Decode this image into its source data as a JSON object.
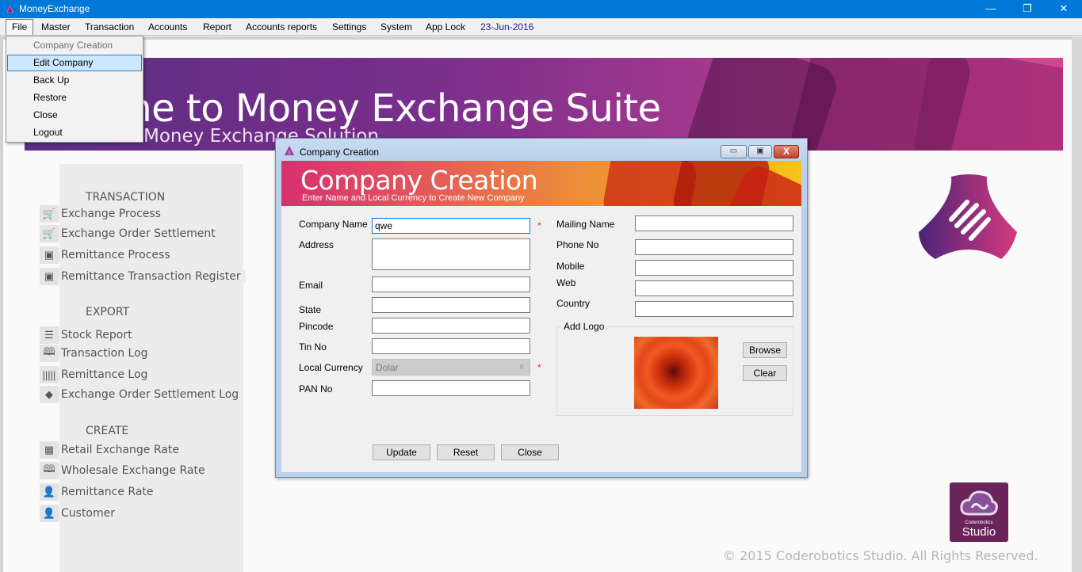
{
  "window": {
    "title": "MoneyExchange",
    "controls": {
      "minimize": "—",
      "restore": "❐",
      "close": "✕"
    }
  },
  "menubar": {
    "items": [
      "File",
      "Master",
      "Transaction",
      "Accounts",
      "Report",
      "Accounts reports",
      "Settings",
      "System",
      "App Lock"
    ],
    "date": "23-Jun-2016",
    "active": "File"
  },
  "file_menu": {
    "items": [
      {
        "label": "Company Creation",
        "state": "disabled"
      },
      {
        "label": "Edit Company",
        "state": "hover"
      },
      {
        "label": "Back Up",
        "state": "normal"
      },
      {
        "label": "Restore",
        "state": "normal"
      },
      {
        "label": "Close",
        "state": "normal"
      },
      {
        "label": "Logout",
        "state": "normal"
      }
    ]
  },
  "banner": {
    "title": "Welcome to Money Exchange Suite",
    "visible_title": "ome to Money Exchange Suite",
    "subtitle": "Complete Money Exchange Solution",
    "visible_subtitle": "Money Exchange Solution"
  },
  "sidebar": {
    "sections": [
      {
        "heading": "TRANSACTION",
        "items": [
          {
            "label": "Exchange Process",
            "icon": "cart-icon"
          },
          {
            "label": "Exchange Order Settlement",
            "icon": "cart-settle-icon"
          },
          {
            "label": "Remittance Process",
            "icon": "wallet-icon"
          },
          {
            "label": "Remittance Transaction Register",
            "icon": "wallet-icon"
          }
        ]
      },
      {
        "heading": "EXPORT",
        "items": [
          {
            "label": "Stock Report",
            "icon": "stock-list-icon"
          },
          {
            "label": "Transaction Log",
            "icon": "book-icon"
          },
          {
            "label": "Remittance Log",
            "icon": "barcode-icon"
          },
          {
            "label": "Exchange Order Settlement Log",
            "icon": "tag-icon"
          }
        ]
      },
      {
        "heading": "CREATE",
        "items": [
          {
            "label": "Retail Exchange Rate",
            "icon": "counter-icon"
          },
          {
            "label": "Wholesale Exchange Rate",
            "icon": "book-icon"
          },
          {
            "label": "Remittance Rate",
            "icon": "person-icon"
          },
          {
            "label": "Customer",
            "icon": "person-icon"
          }
        ]
      }
    ]
  },
  "dialog": {
    "title": "Company Creation",
    "banner_title": "Company Creation",
    "banner_subtitle": "Enter Name and Local Currency to Create New Company",
    "fields_left": {
      "company_name": {
        "label": "Company Name",
        "value": "qwe",
        "required": true
      },
      "address": {
        "label": "Address",
        "value": ""
      },
      "email": {
        "label": "Email",
        "value": ""
      },
      "state": {
        "label": "State",
        "value": ""
      },
      "pincode": {
        "label": "Pincode",
        "value": ""
      },
      "tin_no": {
        "label": "Tin No",
        "value": ""
      },
      "local_currency": {
        "label": "Local Currency",
        "value": "Dolar",
        "required": true
      },
      "pan_no": {
        "label": "PAN No",
        "value": ""
      }
    },
    "fields_right": {
      "mailing_name": {
        "label": "Mailing Name",
        "value": ""
      },
      "phone_no": {
        "label": "Phone No",
        "value": ""
      },
      "mobile": {
        "label": "Mobile",
        "value": ""
      },
      "web": {
        "label": "Web",
        "value": ""
      },
      "country": {
        "label": "Country",
        "value": ""
      }
    },
    "required_mark": "*",
    "logo_group": {
      "label": "Add Logo",
      "browse": "Browse",
      "clear": "Clear"
    },
    "buttons": {
      "update": "Update",
      "reset": "Reset",
      "close": "Close"
    },
    "controls": {
      "minimize": "▭",
      "maximize": "▣",
      "close": "X"
    }
  },
  "footer": {
    "studio_small": "Coderobotics",
    "studio_big": "Studio",
    "copyright": "© 2015 Coderobotics Studio. All Rights Reserved."
  },
  "colors": {
    "titlebar": "#0078d7",
    "banner_start": "#5c2d82",
    "banner_end": "#d8458f",
    "dialog_frame": "#b9d1ea",
    "menu_hover": "#cce8ff",
    "required": "#d03030",
    "date": "#1a1aa0"
  }
}
